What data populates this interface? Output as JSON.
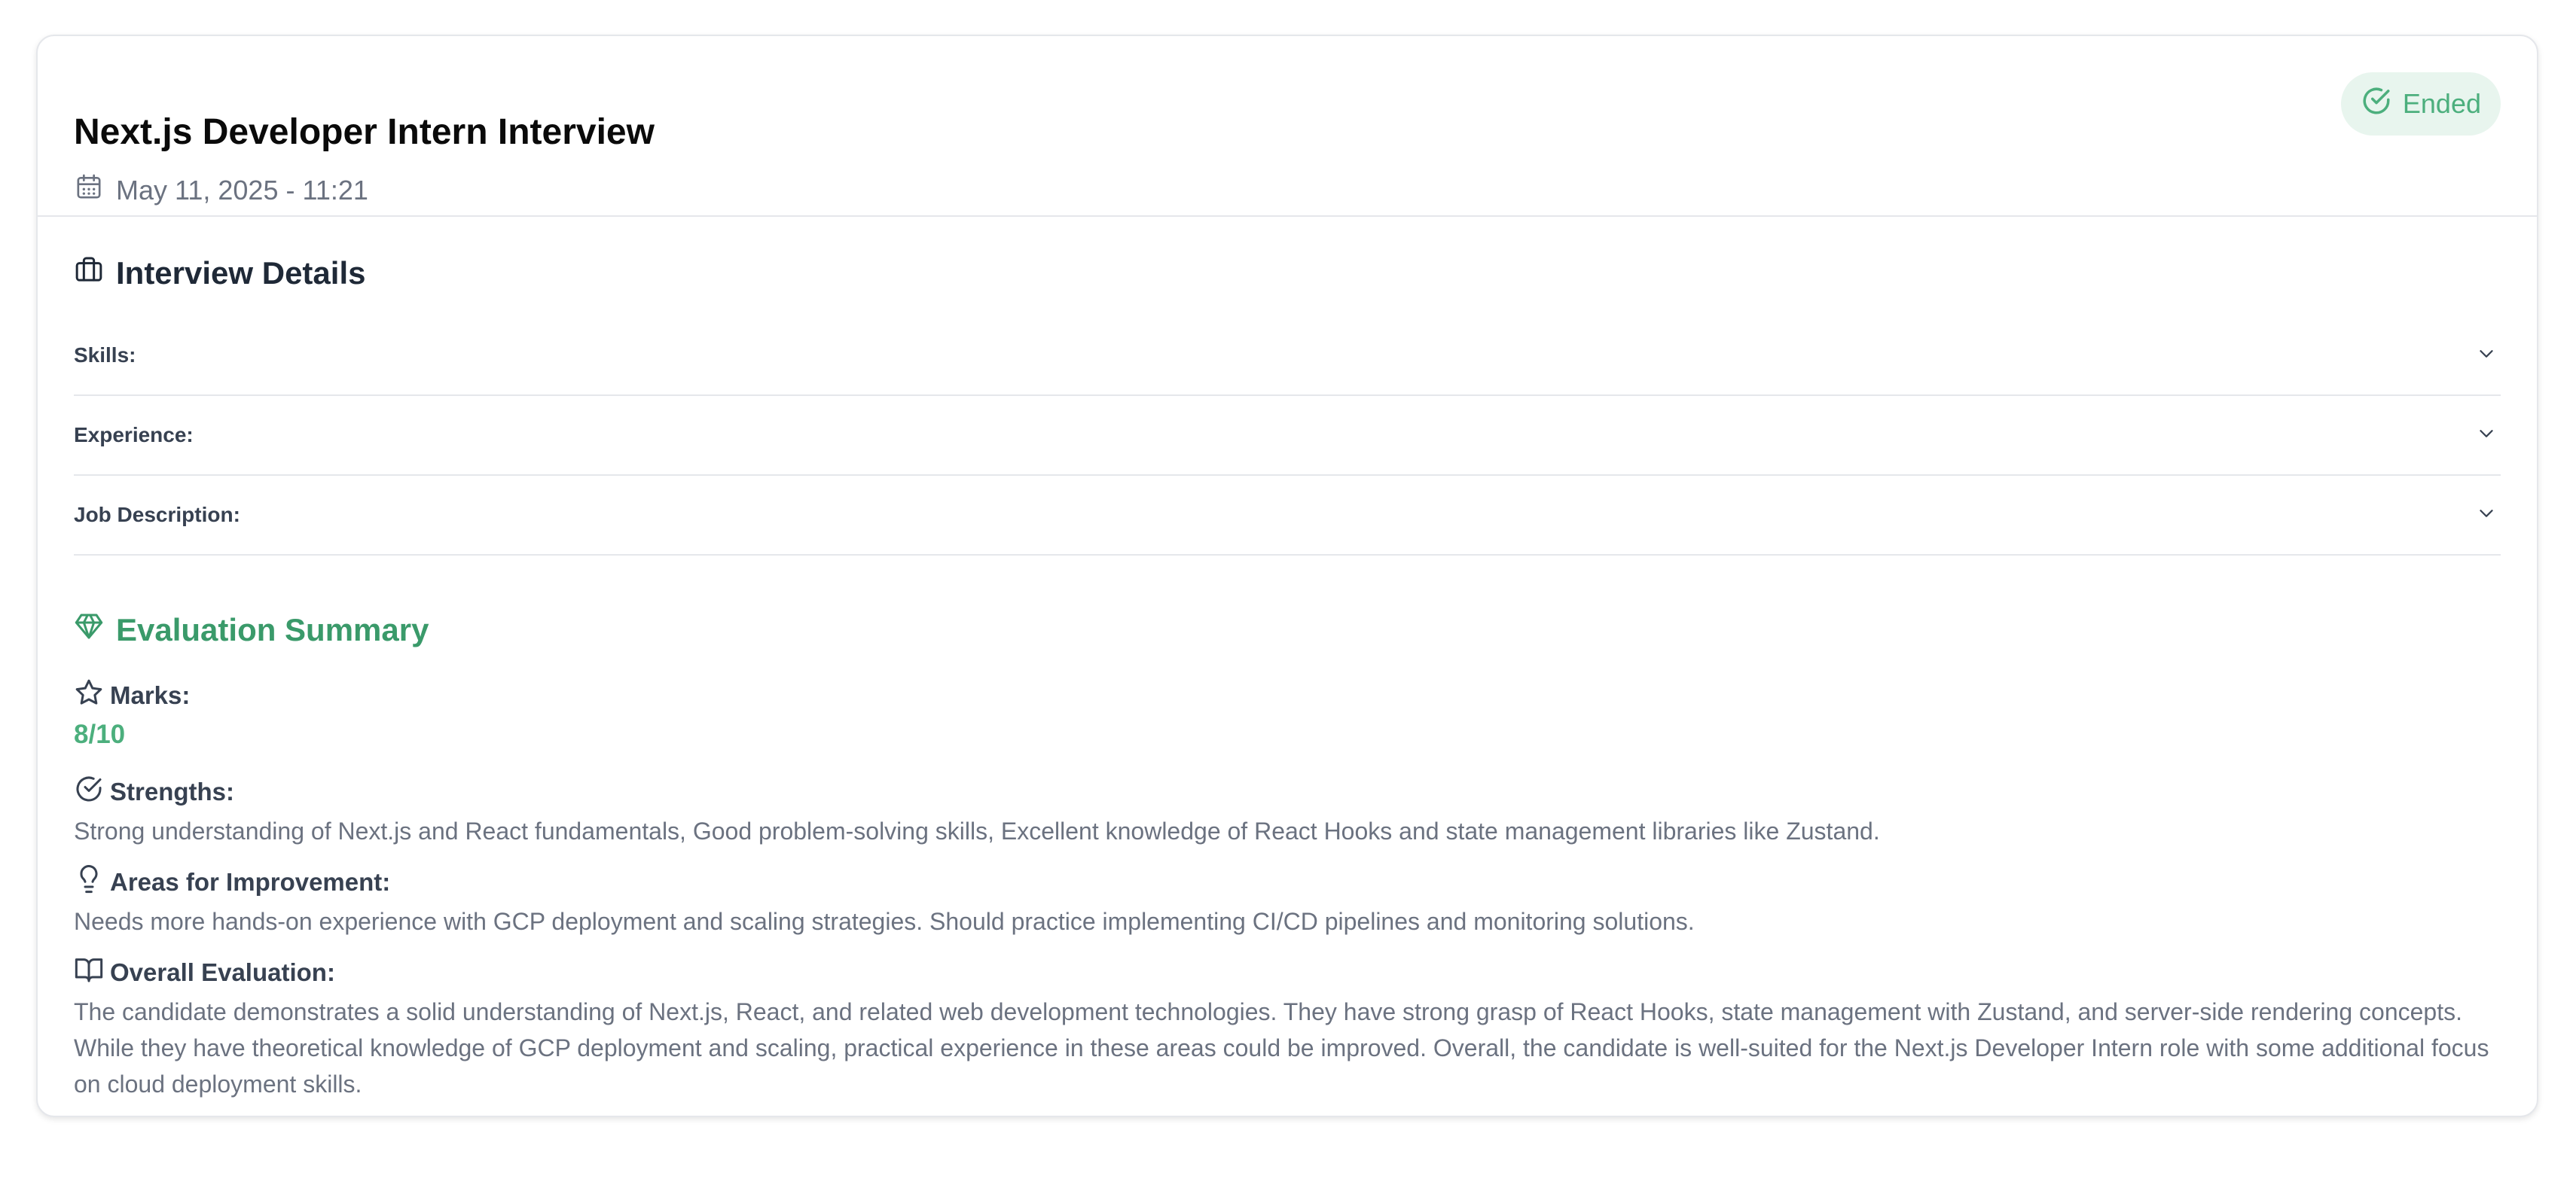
{
  "header": {
    "title": "Next.js Developer Intern Interview",
    "date": "May 11, 2025 - 11:21",
    "status": "Ended",
    "status_color": "#4caf7d"
  },
  "details": {
    "heading": "Interview Details",
    "items": [
      {
        "label": "Skills:"
      },
      {
        "label": "Experience:"
      },
      {
        "label": "Job Description:"
      }
    ]
  },
  "evaluation": {
    "heading": "Evaluation Summary",
    "accent_color": "#3a9a6a",
    "marks_label": "Marks:",
    "marks_value": "8/10",
    "strengths_label": "Strengths:",
    "strengths_text": "Strong understanding of Next.js and React fundamentals, Good problem-solving skills, Excellent knowledge of React Hooks and state management libraries like Zustand.",
    "improvement_label": "Areas for Improvement:",
    "improvement_text": "Needs more hands-on experience with GCP deployment and scaling strategies. Should practice implementing CI/CD pipelines and monitoring solutions.",
    "overall_label": "Overall Evaluation:",
    "overall_text": "The candidate demonstrates a solid understanding of Next.js, React, and related web development technologies. They have strong grasp of React Hooks, state management with Zustand, and server-side rendering concepts. While they have theoretical knowledge of GCP deployment and scaling, practical experience in these areas could be improved. Overall, the candidate is well-suited for the Next.js Developer Intern role with some additional focus on cloud deployment skills."
  },
  "icons": {
    "date": "calendar-icon",
    "status": "check-circle-icon",
    "details": "briefcase-icon",
    "accordion": "chevron-down-icon",
    "evaluation": "gem-icon",
    "marks": "star-icon",
    "strengths": "check-circle-icon",
    "improvement": "lightbulb-icon",
    "overall": "book-open-icon"
  }
}
